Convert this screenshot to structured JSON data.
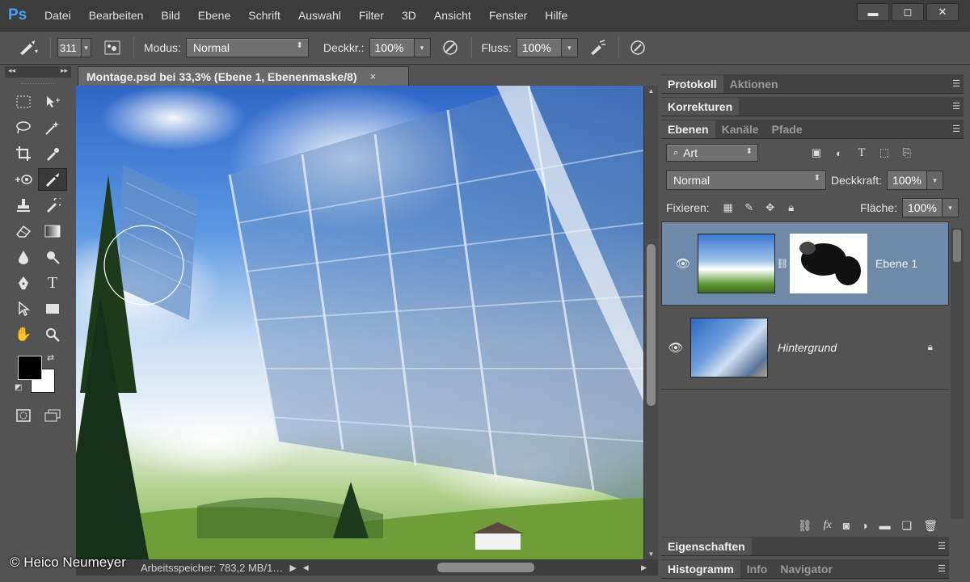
{
  "app": {
    "logo": "Ps"
  },
  "menu": [
    "Datei",
    "Bearbeiten",
    "Bild",
    "Ebene",
    "Schrift",
    "Auswahl",
    "Filter",
    "3D",
    "Ansicht",
    "Fenster",
    "Hilfe"
  ],
  "window_buttons": {
    "minimize": "▬",
    "restore": "◻",
    "close": "✕"
  },
  "options": {
    "brush_size": "311",
    "modus_label": "Modus:",
    "modus_value": "Normal",
    "deckkr_label": "Deckkr.:",
    "deckkr_value": "100%",
    "fluss_label": "Fluss:",
    "fluss_value": "100%"
  },
  "document": {
    "tab_title": "Montage.psd bei 33,3% (Ebene 1, Ebenenmaske/8)",
    "close": "×",
    "status_text": "Arbeitsspeicher: 783,2 MB/1…"
  },
  "credit": "© Heico Neumeyer",
  "panels": {
    "top_tabs": [
      "Protokoll",
      "Aktionen"
    ],
    "korrekturen": "Korrekturen",
    "layers_tabs": [
      "Ebenen",
      "Kanäle",
      "Pfade"
    ],
    "filter_kind": "Art",
    "blend_mode": "Normal",
    "deckkraft_label": "Deckkraft:",
    "deckkraft_value": "100%",
    "fixieren_label": "Fixieren:",
    "flaeche_label": "Fläche:",
    "flaeche_value": "100%",
    "layers": [
      {
        "name": "Ebene 1",
        "selected": true
      },
      {
        "name": "Hintergrund",
        "selected": false
      }
    ],
    "eigenschaften": "Eigenschaften",
    "bottom_tabs": [
      "Histogramm",
      "Info",
      "Navigator"
    ]
  },
  "colors": {
    "accent": "#45a3ff",
    "selected_layer": "#6f8aa8",
    "foreground": "#000000",
    "background": "#ffffff"
  }
}
